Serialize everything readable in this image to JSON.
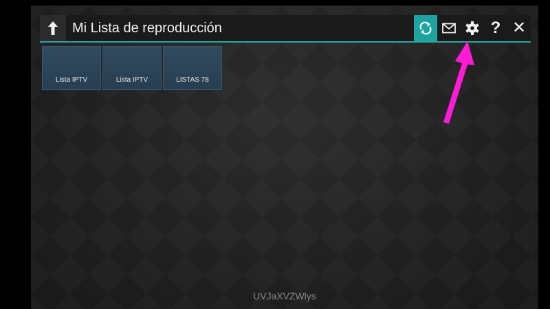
{
  "header": {
    "title": "Mi Lista de reproducción",
    "back_icon": "arrow-up-icon",
    "toolbar": [
      {
        "name": "refresh-button",
        "icon": "refresh-icon"
      },
      {
        "name": "mail-button",
        "icon": "envelope-icon"
      },
      {
        "name": "settings-button",
        "icon": "gear-icon"
      },
      {
        "name": "help-button",
        "label": "?"
      },
      {
        "name": "close-button",
        "label": "✕"
      }
    ]
  },
  "playlists": [
    {
      "label": "Lista IPTV"
    },
    {
      "label": "Lista IPTV"
    },
    {
      "label": "LISTAS 78"
    }
  ],
  "footer": {
    "code": "UVJaXVZWlys"
  },
  "colors": {
    "accent": "#1ea3a0",
    "tile": "#2b4255",
    "annotation": "#ff1ad6"
  }
}
